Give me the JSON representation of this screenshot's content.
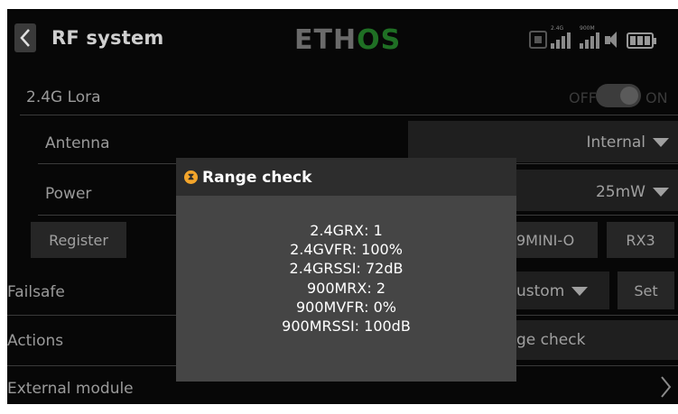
{
  "header": {
    "title": "RF system",
    "logo": "ETHOS",
    "logo_left": "ETH",
    "logo_right": "OS"
  },
  "status": {
    "signal_2g4_label": "2.4G",
    "signal_900m_label": "900M"
  },
  "rows": {
    "lora": {
      "label": "2.4G Lora",
      "toggle_off": "OFF",
      "toggle_on": "ON",
      "state": "on"
    },
    "antenna": {
      "label": "Antenna",
      "value": "Internal"
    },
    "power": {
      "label": "Power",
      "value": "25mW"
    },
    "register": {
      "label": "Register",
      "receiver": "9MINI-O",
      "slot": "RX3"
    },
    "failsafe": {
      "label": "Failsafe",
      "mode": "ustom",
      "set": "Set"
    },
    "actions": {
      "label": "Actions",
      "button": "ge check"
    },
    "external": {
      "label": "External module"
    }
  },
  "dialog": {
    "title": "Range check",
    "lines": [
      "2.4GRX: 1",
      "2.4GVFR: 100%",
      "2.4GRSSI: 72dB",
      "900MRX: 2",
      "900MVFR: 0%",
      "900MRSSI: 100dB"
    ]
  },
  "colors": {
    "accent": "#1f6f24",
    "warning_icon": "#f3a52b",
    "background": "#070707",
    "dialog_bg": "#454545"
  }
}
